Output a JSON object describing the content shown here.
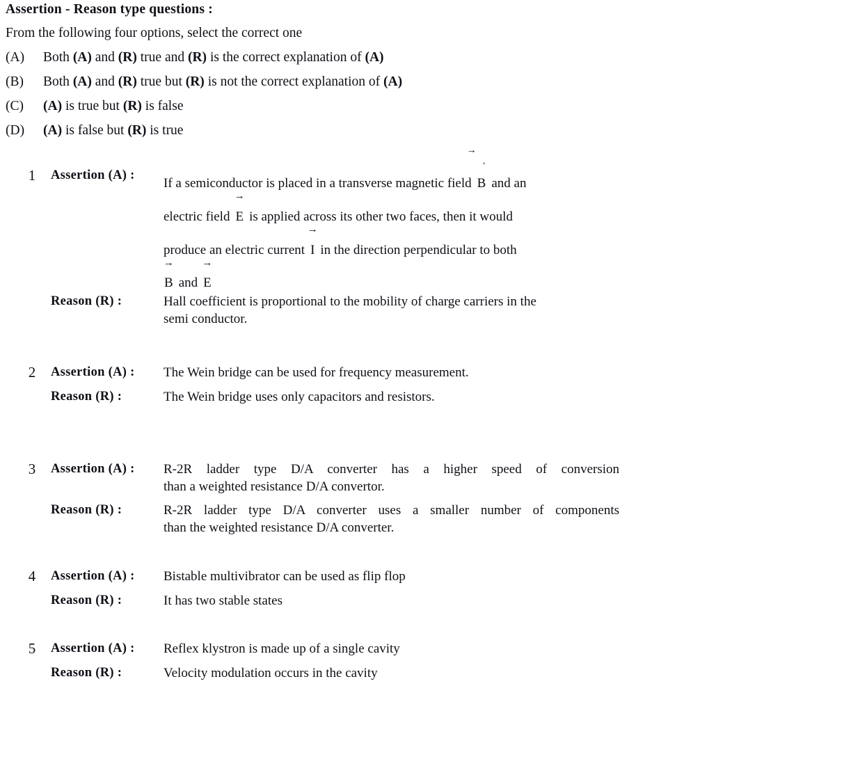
{
  "header": {
    "title": "Assertion - Reason type questions :",
    "instruction": "From the following four options, select the correct one"
  },
  "options": [
    {
      "key": "(A)",
      "text_pre": "Both ",
      "bold1": "(A)",
      "mid1": " and ",
      "bold2": "(R)",
      "mid2": " true and ",
      "bold3": "(R)",
      "mid3": " is the correct explanation of ",
      "bold4": "(A)",
      "full": "Both (A) and (R) true and (R) is the correct explanation of (A)"
    },
    {
      "key": "(B)",
      "text_pre": "Both ",
      "bold1": "(A)",
      "mid1": " and ",
      "bold2": "(R)",
      "mid2": " true but ",
      "bold3": "(R)",
      "mid3": " is not the correct explanation of ",
      "bold4": "(A)",
      "full": "Both (A) and (R) true but (R) is not the correct explanation of (A)"
    },
    {
      "key": "(C)",
      "text_pre": "",
      "bold1": "(A)",
      "mid1": " is true but ",
      "bold2": "(R)",
      "mid2": " is false",
      "bold3": "",
      "mid3": "",
      "bold4": "",
      "full": "(A) is true but (R) is false"
    },
    {
      "key": "(D)",
      "text_pre": "",
      "bold1": "(A)",
      "mid1": " is false but ",
      "bold2": "(R)",
      "mid2": " is true",
      "bold3": "",
      "mid3": "",
      "bold4": "",
      "full": "(A) is false but (R) is true"
    }
  ],
  "labels": {
    "assertion": "Assertion (A) :",
    "reason": "Reason (R) :"
  },
  "questions": [
    {
      "number": "1",
      "assertion_lines": [
        "If a semiconductor is placed in a transverse magnetic field",
        "and an",
        "electric field",
        "is applied across its other two faces, then it would",
        "produce an electric current",
        "in the direction perpendicular to both",
        "and"
      ],
      "assertion_vectors": [
        "B",
        "E",
        "I",
        "B",
        "E"
      ],
      "assertion_text": "If a semiconductor is placed in a transverse magnetic field B and an electric field E is applied across its other two faces, then it would produce an electric current I in the direction perpendicular to both B and E",
      "reason_lines": [
        "Hall coefficient is proportional to the mobility of charge carriers in the",
        "semi conductor."
      ]
    },
    {
      "number": "2",
      "assertion_lines": [
        "The Wein bridge can be used for frequency measurement."
      ],
      "reason_lines": [
        "The Wein bridge uses only capacitors and resistors."
      ]
    },
    {
      "number": "3",
      "assertion_lines": [
        "R-2R ladder type D/A converter has a higher speed of conversion",
        "than a weighted resistance D/A convertor."
      ],
      "reason_lines": [
        "R-2R ladder type D/A converter uses a smaller number of components",
        "than the weighted resistance D/A converter."
      ]
    },
    {
      "number": "4",
      "assertion_lines": [
        "Bistable multivibrator can be used as flip flop"
      ],
      "reason_lines": [
        "It has two stable states"
      ]
    },
    {
      "number": "5",
      "assertion_lines": [
        "Reflex klystron is made up of a single cavity"
      ],
      "reason_lines": [
        "Velocity modulation occurs in the cavity"
      ]
    }
  ],
  "symbols": {
    "arrow": "→"
  },
  "colors": {
    "text": "#100f16",
    "background": "#ffffff"
  }
}
